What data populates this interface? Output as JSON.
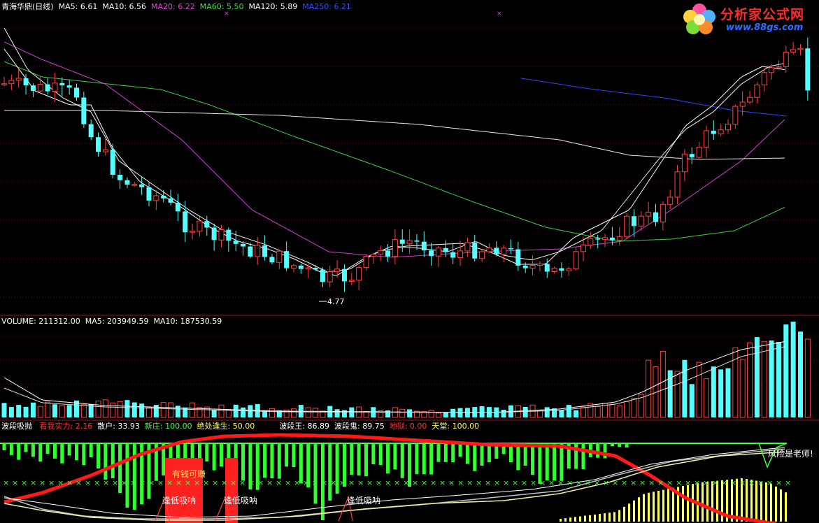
{
  "price_panel": {
    "title": "青海华鼎(日线)",
    "ma5": {
      "label": "MA5:",
      "value": "6.61",
      "color": "#ffffff"
    },
    "ma10": {
      "label": "MA10:",
      "value": "6.56",
      "color": "#ffffff"
    },
    "ma20": {
      "label": "MA20:",
      "value": "6.22",
      "color": "#e040e0"
    },
    "ma60": {
      "label": "MA60:",
      "value": "5.50",
      "color": "#40e040"
    },
    "ma120": {
      "label": "MA120:",
      "value": "5.89",
      "color": "#ffffff"
    },
    "ma250": {
      "label": "MA250:",
      "value": "6.21",
      "color": "#3050ff"
    },
    "low_marker": "4.77"
  },
  "volume_panel": {
    "volume": {
      "label": "VOLUME:",
      "value": "211312.00"
    },
    "ma5": {
      "label": "MA5:",
      "value": "203949.59"
    },
    "ma10": {
      "label": "MA10:",
      "value": "187530.59"
    }
  },
  "indicator_panel": {
    "name": "波段吸抛",
    "fields": [
      {
        "label": "看我实力:",
        "value": "2.16",
        "color": "#ff3030"
      },
      {
        "label": "散户:",
        "value": "33.93",
        "color": "#ffffff"
      },
      {
        "label": "新庄:",
        "value": "100.00",
        "color": "#40ff40"
      },
      {
        "label": "绝处逢生:",
        "value": "50.00",
        "color": "#ffff40"
      },
      {
        "label": "波段王:",
        "value": "86.89",
        "color": "#ffffff"
      },
      {
        "label": "波段鬼:",
        "value": "89.75",
        "color": "#ffffff"
      },
      {
        "label": "地狱:",
        "value": "0.00",
        "color": "#ff3030"
      },
      {
        "label": "天堂:",
        "value": "100.00",
        "color": "#ffff40"
      }
    ],
    "annotations": {
      "profit": "有钱可赚",
      "buy": "逢低吸呐",
      "teacher": "风险是老师!"
    }
  },
  "logo": {
    "title": "分析家公式网",
    "url": "www.88gs.com"
  },
  "chart_data": [
    {
      "type": "candlestick",
      "title": "青海华鼎(日线)",
      "annotated_low": 4.77,
      "moving_averages": [
        {
          "name": "MA5",
          "last": 6.61
        },
        {
          "name": "MA10",
          "last": 6.56
        },
        {
          "name": "MA20",
          "last": 6.22
        },
        {
          "name": "MA60",
          "last": 5.5
        },
        {
          "name": "MA120",
          "last": 5.89
        },
        {
          "name": "MA250",
          "last": 6.21
        }
      ]
    },
    {
      "type": "bar",
      "title": "VOLUME",
      "last": 211312.0,
      "moving_averages": [
        {
          "name": "MA5",
          "last": 203949.59
        },
        {
          "name": "MA10",
          "last": 187530.59
        }
      ]
    },
    {
      "type": "area",
      "title": "波段吸抛",
      "values": {
        "看我实力": 2.16,
        "散户": 33.93,
        "新庄": 100.0,
        "绝处逢生": 50.0,
        "波段王": 86.89,
        "波段鬼": 89.75,
        "地狱": 0.0,
        "天堂": 100.0
      }
    }
  ]
}
